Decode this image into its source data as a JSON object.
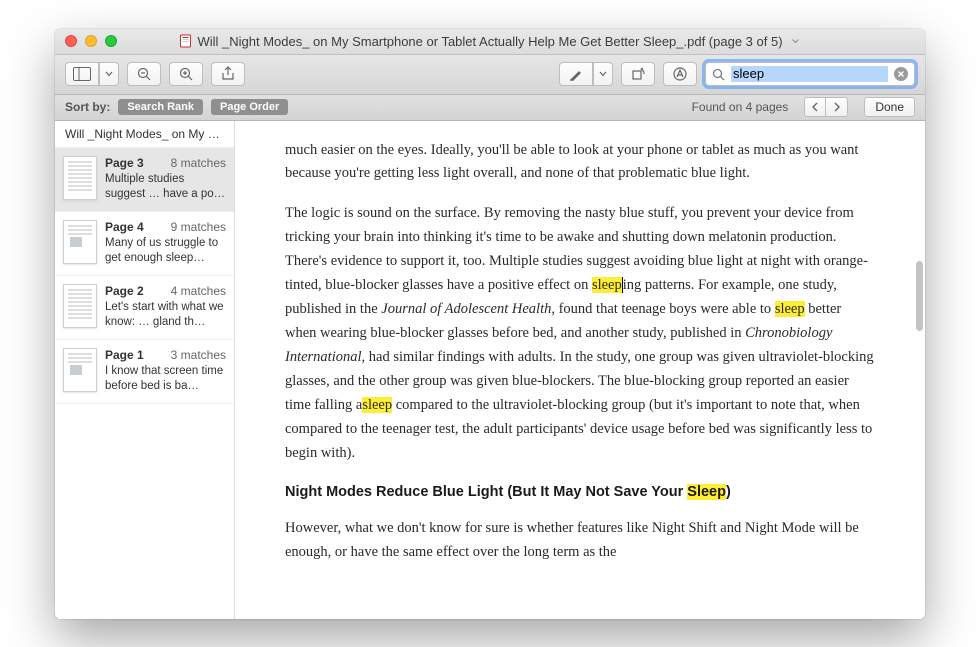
{
  "window": {
    "title": "Will _Night Modes_ on My Smartphone or Tablet Actually Help Me Get Better Sleep_.pdf (page 3 of 5)"
  },
  "search": {
    "value": "sleep"
  },
  "sortbar": {
    "label": "Sort by:",
    "opt1": "Search Rank",
    "opt2": "Page Order",
    "found": "Found on 4 pages",
    "done": "Done"
  },
  "sidebar": {
    "doc_title": "Will _Night Modes_ on My Sma…",
    "results": [
      {
        "page": "Page 3",
        "count": "8 matches",
        "snippet": "Multiple studies suggest … have a po…",
        "selected": true,
        "thumb": "text"
      },
      {
        "page": "Page 4",
        "count": "9 matches",
        "snippet": "Many of us struggle to get enough sleep…",
        "selected": false,
        "thumb": "img"
      },
      {
        "page": "Page 2",
        "count": "4 matches",
        "snippet": "Let's start with what we know: … gland th…",
        "selected": false,
        "thumb": "text"
      },
      {
        "page": "Page 1",
        "count": "3 matches",
        "snippet": "I know that screen time before bed is ba…",
        "selected": false,
        "thumb": "img"
      }
    ]
  },
  "content": {
    "p1": "much easier on the eyes. Ideally, you'll be able to look at your phone or tablet as much as you want because you're getting less light overall, and none of that problematic blue light.",
    "p2a": "The logic is sound on the surface. By removing the nasty blue stuff, you prevent your device from tricking your brain into thinking it's time to be awake and shutting down melatonin production. There's evidence to support it, too. Multiple studies suggest avoiding blue light at night with orange-tinted, blue-blocker glasses have a positive effect on ",
    "p2_hl1": "sleep",
    "p2b": "ing patterns. For example, one study, published in the ",
    "p2_j1": "Journal of Adolescent Health",
    "p2c": ", found that teenage boys were able to ",
    "p2_hl2": "sleep",
    "p2d": " better when wearing blue-blocker glasses before bed, and another study, published in ",
    "p2_j2": "Chronobiology International",
    "p2e": ", had similar findings with adults. In the study, one group was given ultraviolet-blocking glasses, and the other group was given blue-blockers. The blue-blocking group reported an easier time falling a",
    "p2_hl3": "sleep",
    "p2f": " compared to the ultraviolet-blocking group (but it's important to note that, when compared to the teenager test, the adult participants' device usage before bed was significantly less to begin with).",
    "h1a": "Night Modes Reduce Blue Light (But It May Not Save Your ",
    "h1_hl": "Sleep",
    "h1b": ")",
    "p3": "However, what we don't know for sure is whether features like Night Shift and Night Mode will be enough, or have the same effect over the long term as the"
  }
}
